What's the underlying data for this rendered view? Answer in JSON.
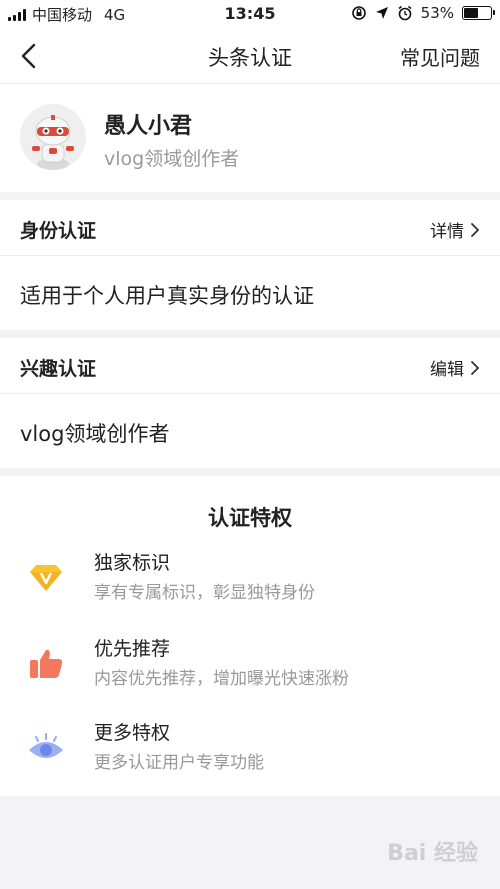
{
  "status_bar": {
    "carrier": "中国移动",
    "network": "4G",
    "time": "13:45",
    "battery_text": "53%",
    "battery_level": 0.53,
    "icons": [
      "signal-icon",
      "lock-rotation-icon",
      "location-icon",
      "alarm-icon",
      "battery-icon"
    ]
  },
  "nav": {
    "back_icon": "chevron-left-icon",
    "title": "头条认证",
    "faq": "常见问题"
  },
  "profile": {
    "name": "愚人小君",
    "subtitle": "vlog领域创作者",
    "avatar_icon": "robot-avatar"
  },
  "identity": {
    "label": "身份认证",
    "action": "详情",
    "description": "适用于个人用户真实身份的认证"
  },
  "interest": {
    "label": "兴趣认证",
    "action": "编辑",
    "description": "vlog领域创作者"
  },
  "perks": {
    "title": "认证特权",
    "items": [
      {
        "name": "独家标识",
        "desc": "享有专属标识，彰显独特身份",
        "icon": "v-diamond-icon",
        "color": "#f7c331"
      },
      {
        "name": "优先推荐",
        "desc": "内容优先推荐，增加曝光快速涨粉",
        "icon": "thumbs-up-icon",
        "color": "#f2785e"
      },
      {
        "name": "更多特权",
        "desc": "更多认证用户专享功能",
        "icon": "eye-icon",
        "color": "#7f9bf0"
      }
    ]
  },
  "watermark": "Bai 经验"
}
